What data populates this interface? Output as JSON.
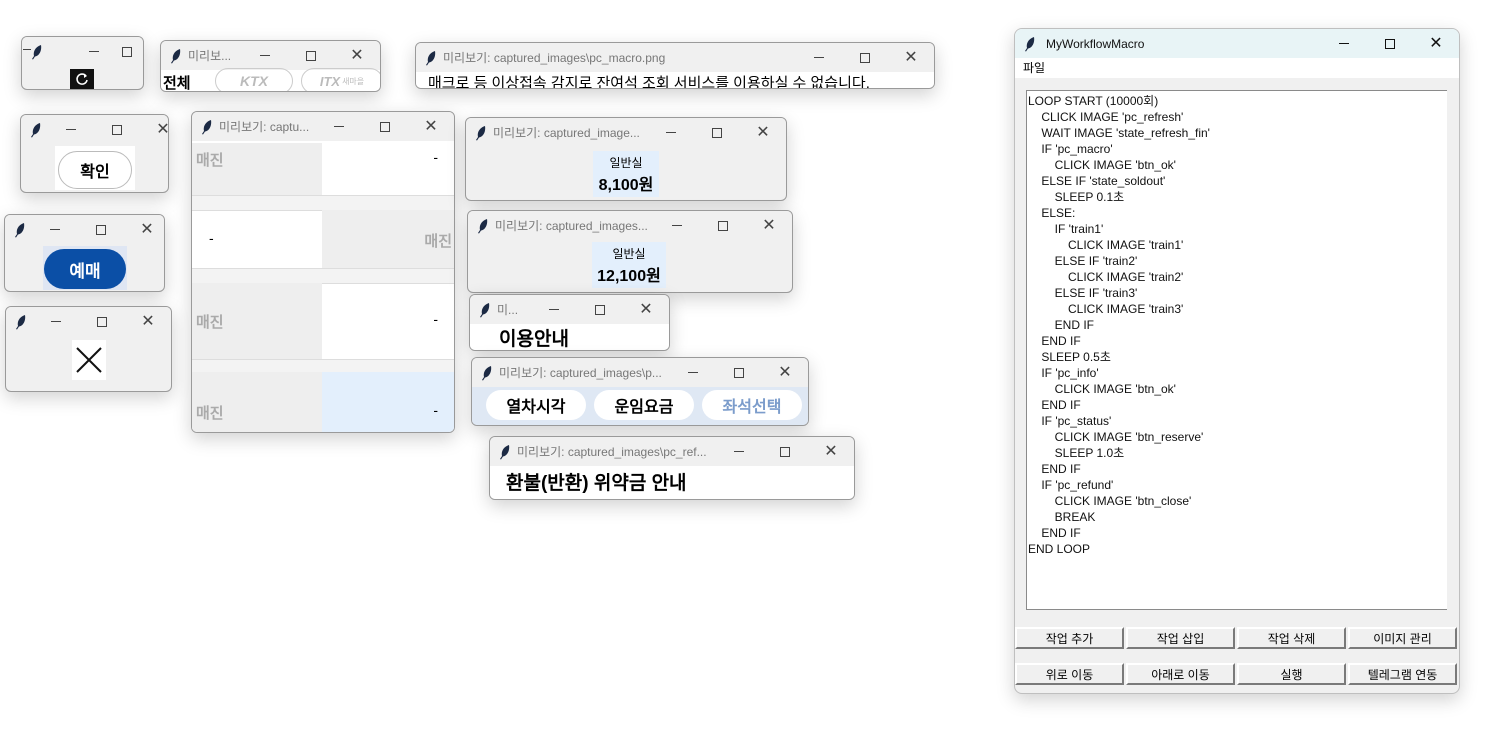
{
  "preview_prefix": "미리보기: captured_images\\",
  "windows": {
    "refresh_win": {
      "title": ""
    },
    "tabs_win": {
      "title": "미리보...",
      "tab1": "전체",
      "tab2": "KTX",
      "tab3": "ITX",
      "tab3_sub": "새마을"
    },
    "macro_warn_win": {
      "title": "미리보기: captured_images\\pc_macro.png",
      "text": "매크로 등 이상접속 감지로 잔여석 조회 서비스를 이용하실 수 없습니다."
    },
    "ok_win": {
      "title": "",
      "button": "확인"
    },
    "reserve_win": {
      "title": "",
      "button": "예매"
    },
    "close_win": {
      "title": ""
    },
    "soldout_win": {
      "title": "미리보기: captu...",
      "rows": [
        {
          "left": "매진",
          "right": "-"
        },
        {
          "left": "-",
          "right": "매진"
        },
        {
          "left": "매진",
          "right": "-"
        },
        {
          "left": "매진",
          "right": "-"
        }
      ]
    },
    "train1_win": {
      "title": "미리보기: captured_image...",
      "class": "일반실",
      "price": "8,100원"
    },
    "train2_win": {
      "title": "미리보기: captured_images...",
      "class": "일반실",
      "price": "12,100원"
    },
    "info_win": {
      "title": "미...",
      "text": "이용안내"
    },
    "tabs2_win": {
      "title": "미리보기: captured_images\\p...",
      "tab1": "열차시각",
      "tab2": "운임요금",
      "tab3": "좌석선택"
    },
    "refund_win": {
      "title": "미리보기: captured_images\\pc_ref...",
      "text": "환불(반환) 위약금 안내"
    }
  },
  "main": {
    "title": "MyWorkflowMacro",
    "menu_file": "파일",
    "script": "LOOP START (10000회)\n    CLICK IMAGE 'pc_refresh'\n    WAIT IMAGE 'state_refresh_fin'\n    IF 'pc_macro'\n        CLICK IMAGE 'btn_ok'\n    ELSE IF 'state_soldout'\n        SLEEP 0.1초\n    ELSE:\n        IF 'train1'\n            CLICK IMAGE 'train1'\n        ELSE IF 'train2'\n            CLICK IMAGE 'train2'\n        ELSE IF 'train3'\n            CLICK IMAGE 'train3'\n        END IF\n    END IF\n    SLEEP 0.5초\n    IF 'pc_info'\n        CLICK IMAGE 'btn_ok'\n    END IF\n    IF 'pc_status'\n        CLICK IMAGE 'btn_reserve'\n        SLEEP 1.0초\n    END IF\n    IF 'pc_refund'\n        CLICK IMAGE 'btn_close'\n        BREAK\n    END IF\nEND LOOP",
    "buttons_row1": [
      "작업 추가",
      "작업 삽입",
      "작업 삭제",
      "이미지 관리"
    ],
    "buttons_row2": [
      "위로 이동",
      "아래로 이동",
      "실행",
      "텔레그램 연동"
    ]
  }
}
